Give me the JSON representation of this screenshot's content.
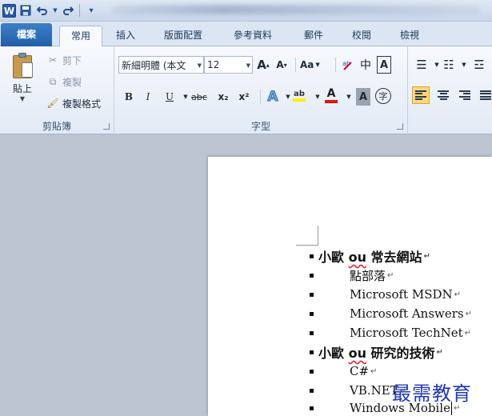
{
  "quick_access": {
    "app_icon": "W",
    "save": "save-icon",
    "undo": "undo-icon",
    "redo": "redo-icon",
    "customize": "customize-icon"
  },
  "tabs": [
    {
      "label": "檔案"
    },
    {
      "label": "常用"
    },
    {
      "label": "插入"
    },
    {
      "label": "版面配置"
    },
    {
      "label": "參考資料"
    },
    {
      "label": "郵件"
    },
    {
      "label": "校閱"
    },
    {
      "label": "檢視"
    }
  ],
  "clipboard": {
    "paste_label": "貼上",
    "cut_label": "剪下",
    "copy_label": "複製",
    "format_painter_label": "複製格式",
    "group_label": "剪貼簿"
  },
  "font": {
    "font_name": "新細明體 (本文",
    "font_size": "12",
    "grow": "A",
    "shrink": "A",
    "change_case": "Aa",
    "bold": "B",
    "italic": "I",
    "underline": "U",
    "strike": "abc",
    "subscript": "x₂",
    "superscript": "x²",
    "group_label": "字型"
  },
  "document": {
    "lines": [
      {
        "text": "小歐 ou 常去網站",
        "heading": true
      },
      {
        "text": "點部落",
        "heading": false
      },
      {
        "text": "Microsoft MSDN",
        "heading": false
      },
      {
        "text": "Microsoft Answers",
        "heading": false
      },
      {
        "text": "Microsoft TechNet",
        "heading": false
      },
      {
        "text": "小歐 ou 研究的技術",
        "heading": true
      },
      {
        "text": "C#",
        "heading": false
      },
      {
        "text": "VB.NET",
        "heading": false
      },
      {
        "text": "Windows Mobile",
        "heading": false
      }
    ]
  },
  "watermark": "最需教育"
}
